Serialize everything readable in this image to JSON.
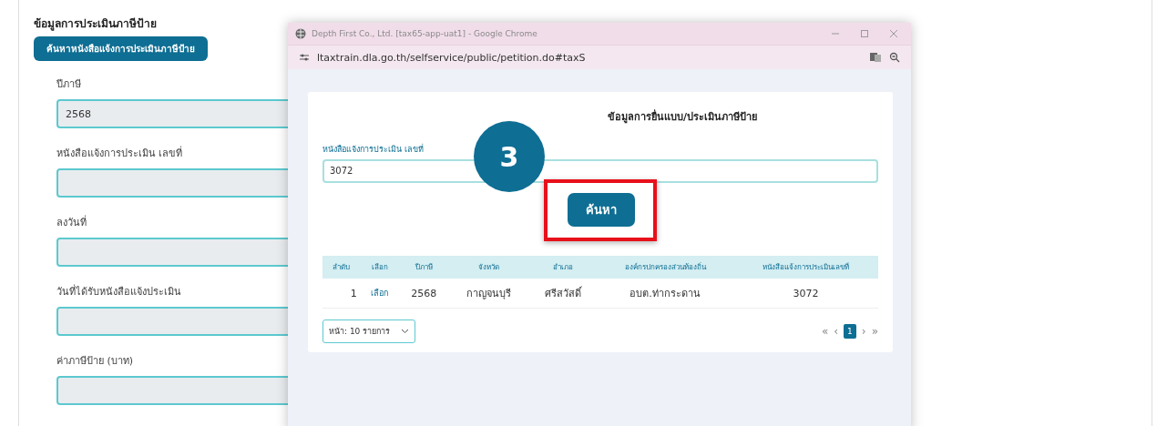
{
  "form": {
    "title": "ข้อมูลการประเมินภาษีป้าย",
    "search_button": "ค้นหาหนังสือแจ้งการประเมินภาษีป้าย",
    "fields": [
      {
        "label": "ปีภาษี",
        "value": "2568"
      },
      {
        "label": "หนังสือแจ้งการประเมิน เลขที่"
      },
      {
        "label": "ลงวันที่"
      },
      {
        "label": "วันที่ได้รับหนังสือแจ้งประเมิน"
      },
      {
        "label": "ค่าภาษีป้าย (บาท)"
      }
    ]
  },
  "popup": {
    "window_title": "Depth First Co., Ltd. [tax65-app-uat1] - Google Chrome",
    "url": "ltaxtrain.dla.go.th/selfservice/public/petition.do#taxS",
    "heading": "ข้อมูลการยื่นแบบ/ประเมินภาษีป้าย",
    "field_label": "หนังสือแจ้งการประเมิน เลขที่",
    "field_value": "3072",
    "search_button": "ค้นหา",
    "table": {
      "columns": [
        "ลำดับ",
        "เลือก",
        "ปีภาษี",
        "จังหวัด",
        "อำเภอ",
        "องค์กรปกครองส่วนท้องถิ่น",
        "หนังสือแจ้งการประเมินเลขที่"
      ],
      "rows": [
        {
          "cells": [
            "1",
            "เลือก",
            "2568",
            "กาญจนบุรี",
            "ศรีสวัสดิ์",
            "อบต.ท่ากระดาน",
            "3072"
          ]
        }
      ]
    },
    "page_size": "หน้า: 10 รายการ",
    "pagination": {
      "first": "«",
      "prev": "‹",
      "pages": [
        {
          "label": "1",
          "selected": true
        }
      ],
      "next": "›",
      "last": "»"
    }
  },
  "callout": {
    "number": "3"
  }
}
